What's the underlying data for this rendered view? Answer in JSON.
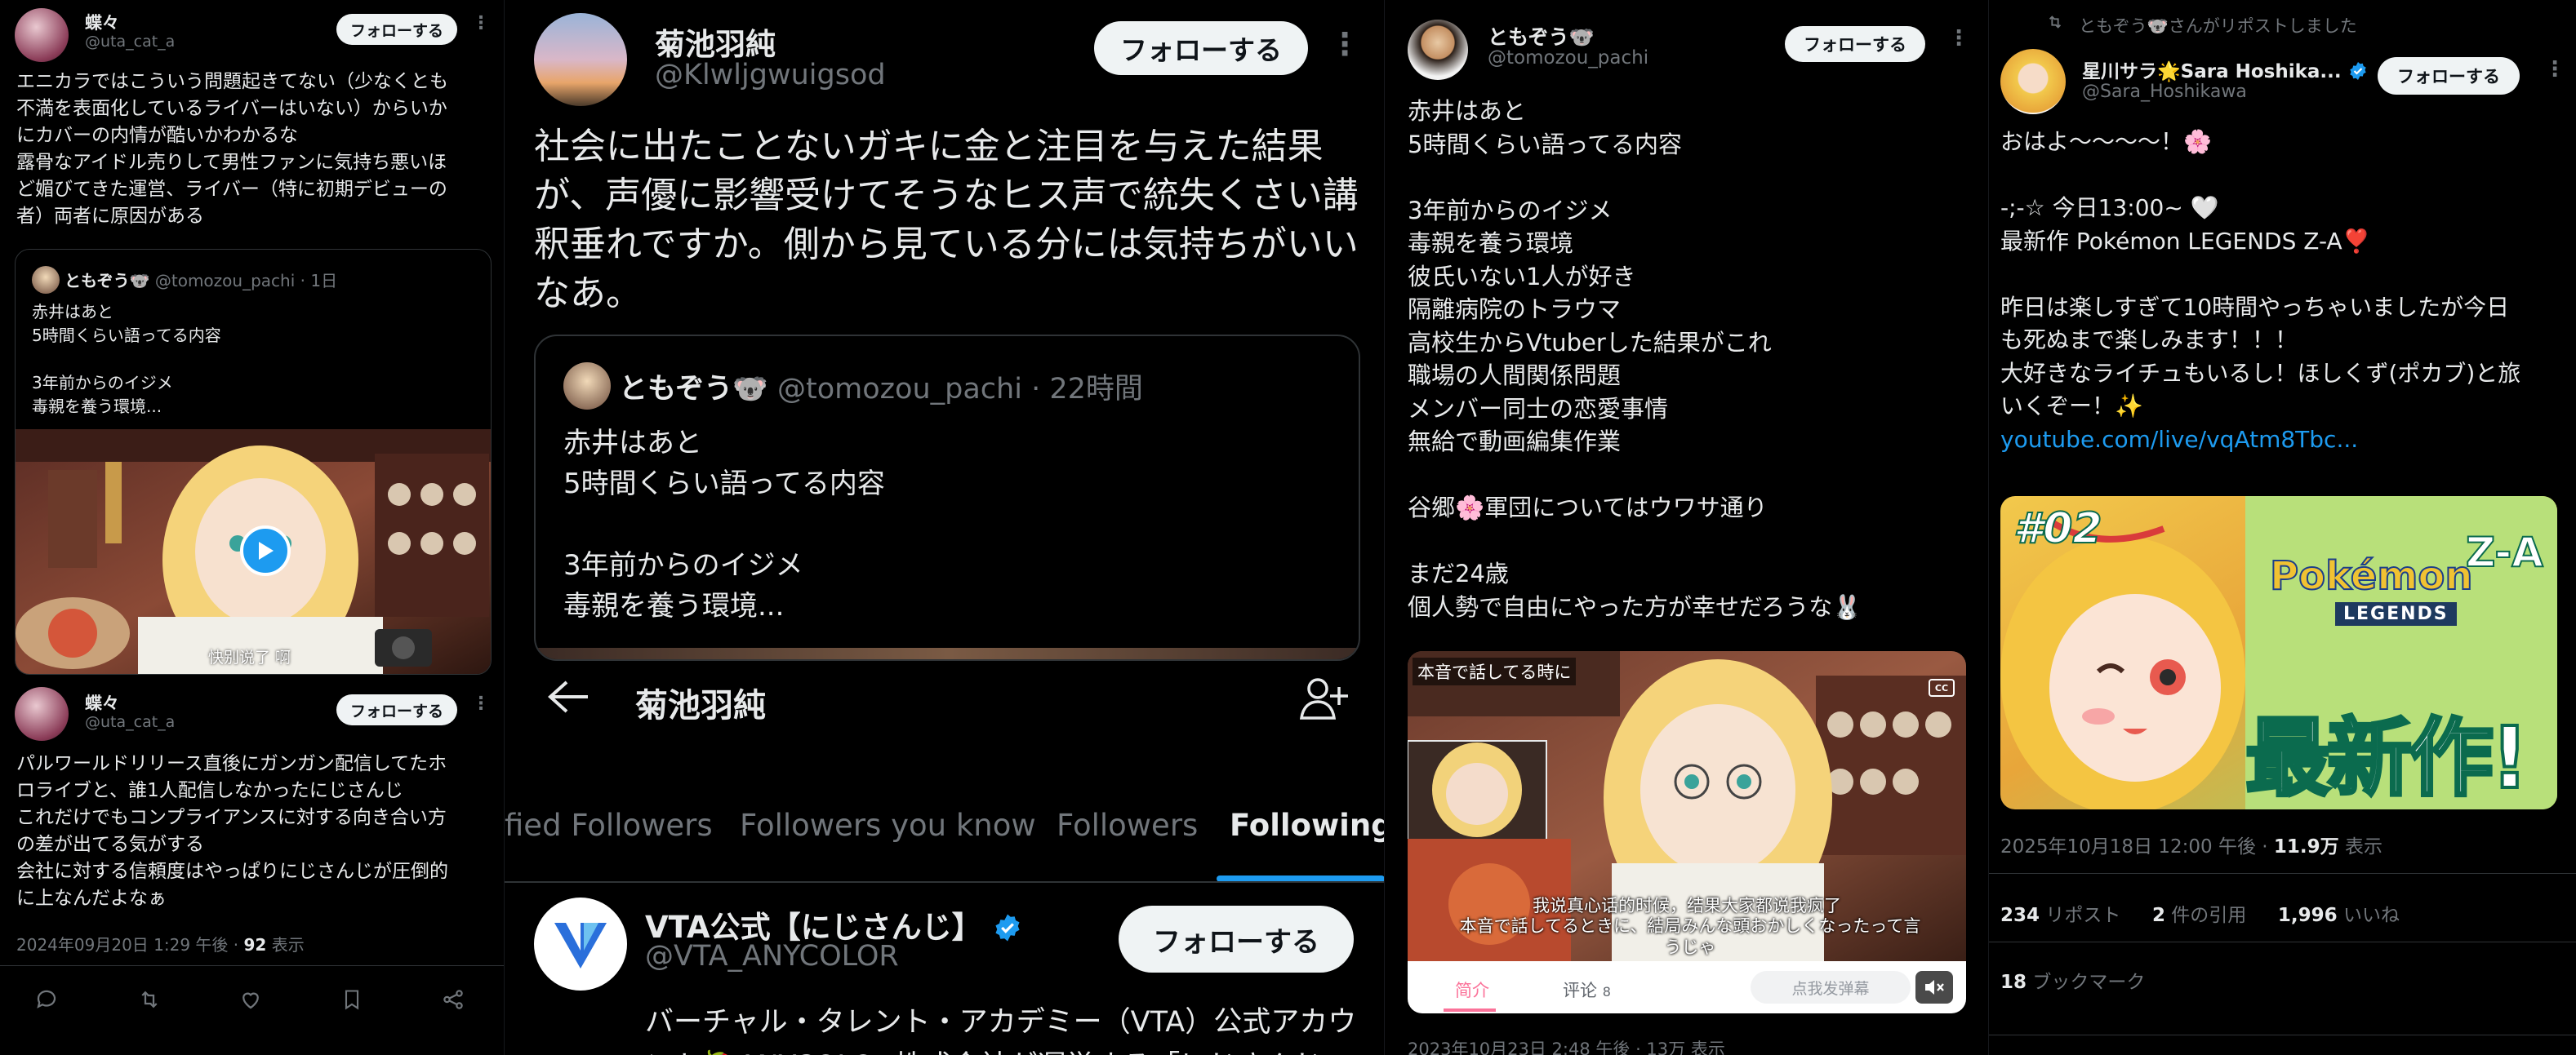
{
  "p1": {
    "user": {
      "name": "蝶々",
      "handle": "@uta_cat_a"
    },
    "follow_label": "フォローする",
    "tweet1_text": "エニカラではこういう問題起きてない（少なくとも\n不満を表面化しているライバーはいない）からいか\nにカバーの内情が酷いかわかるな\n露骨なアイドル売りして男性ファンに気持ち悪いほ\nど媚びてきた運営、ライバー（特に初期デビューの\n者）両者に原因がある",
    "quote": {
      "name": "ともぞう🐨",
      "handle": "@tomozou_pachi",
      "time": "· 1日",
      "text": "赤井はあと\n5時間くらい語ってる内容\n\n3年前からのイジメ\n毒親を養う環境..."
    },
    "video_caption": "快别说了 啊",
    "tweet2_text": "パルワールドリリース直後にガンガン配信してたホ\nロライブと、誰1人配信しなかったにじさんじ\nこれだけでもコンプライアンスに対する向き合い方\nの差が出てる気がする\n会社に対する信頼度はやっぱりにじさんじが圧倒的\nに上なんだよなぁ",
    "meta_date": "2024年09月20日 1:29 午後 · ",
    "meta_views_num": "92",
    "meta_views_label": " 表示"
  },
  "p2": {
    "user": {
      "name": "菊池羽純",
      "handle": "@Klwljgwuigsod"
    },
    "follow_label": "フォローする",
    "tweet_text": "社会に出たことないガキに金と注目を与えた結果\nが、声優に影響受けてそうなヒス声で統失くさい講\n釈垂れですか。側から見ている分には気持ちがいい\nなあ。",
    "quote": {
      "name": "ともぞう🐨",
      "handle": "@tomozou_pachi",
      "time": "· 22時間",
      "text": "赤井はあと\n5時間くらい語ってる内容\n\n3年前からのイジメ\n毒親を養う環境..."
    },
    "header_title": "菊池羽純",
    "tabs": [
      "fied Followers",
      "Followers you know",
      "Followers",
      "Following"
    ],
    "active_tab": "Following",
    "row": {
      "name": "VTA公式【にじさんじ】",
      "handle": "@VTA_ANYCOLOR",
      "follow_label": "フォローする",
      "bio": "バーチャル・タレント・アカデミー（VTA）公式アカウ\nント🍓ANYCOLOR株式会社が運営する「にじさんじ"
    }
  },
  "p3": {
    "user": {
      "name": "ともぞう🐨",
      "handle": "@tomozou_pachi"
    },
    "follow_label": "フォローする",
    "text": "赤井はあと\n5時間くらい語ってる内容\n\n3年前からのイジメ\n毒親を養う環境\n彼氏いない1人が好き\n隔離病院のトラウマ\n高校生からVtuberした結果がこれ\n職場の人間関係問題\nメンバー同士の恋愛事情\n無給で動画編集作業\n\n谷郷🌸軍団についてはウワサ通り\n\nまだ24歳\n個人勢で自由にやった方が幸せだろうな🐰",
    "video": {
      "top_caption": "本音で話してる時に",
      "sub_cn": "我说真心话的时候，结果大家都说我疯了",
      "sub_jp": "本音で話してるときに、結局みんな頭おかしくなったって言\nうじゃ",
      "cc_label": "CC",
      "tab_intro": "简介",
      "tab_comments": "评论",
      "comment_count": "8",
      "danmaku": "点我发弹幕"
    },
    "meta_partial": "2023年10月23日 2:48 午後 · 13万 表示"
  },
  "p4": {
    "repost_text": "ともぞう🐨さんがリポストしました",
    "user": {
      "name": "星川サラ🌟Sara Hoshika...",
      "handle": "@Sara_Hoshikawa"
    },
    "follow_label": "フォローする",
    "text_lines": [
      "おはよ〜〜〜〜！🌸",
      "",
      "-;-☆ 今日13:00~ 🤍",
      "最新作 Pokémon LEGENDS Z-A❣️",
      "",
      "昨日は楽しすぎて10時間やっちゃいましたが今日",
      "も死ぬまで楽しみます！！！",
      "大好きなライチュもいるし！ほしくず(ポカブ)と旅",
      "いくぞー！✨"
    ],
    "link": "youtube.com/live/vqAtm8Tbc...",
    "image": {
      "badge": "#02",
      "logo_main": "Pokémon",
      "logo_sub": "LEGENDS",
      "logo_za": "Z-A",
      "big_text": "最新作!"
    },
    "meta_date": "2025年10月18日 12:00 午後 · ",
    "meta_views_num": "11.9万",
    "meta_views_label": " 表示",
    "stats": {
      "reposts_num": "234",
      "reposts_label": " リポスト",
      "quotes_num": "2",
      "quotes_label": " 件の引用",
      "likes_num": "1,996",
      "likes_label": " いいね",
      "bookmarks_num": "18",
      "bookmarks_label": " ブックマーク"
    }
  },
  "colors": {
    "background": "#000000",
    "text": "#e7e9ea",
    "muted": "#71767b",
    "accent": "#1d9bf0",
    "button_bg": "#eff3f4"
  }
}
